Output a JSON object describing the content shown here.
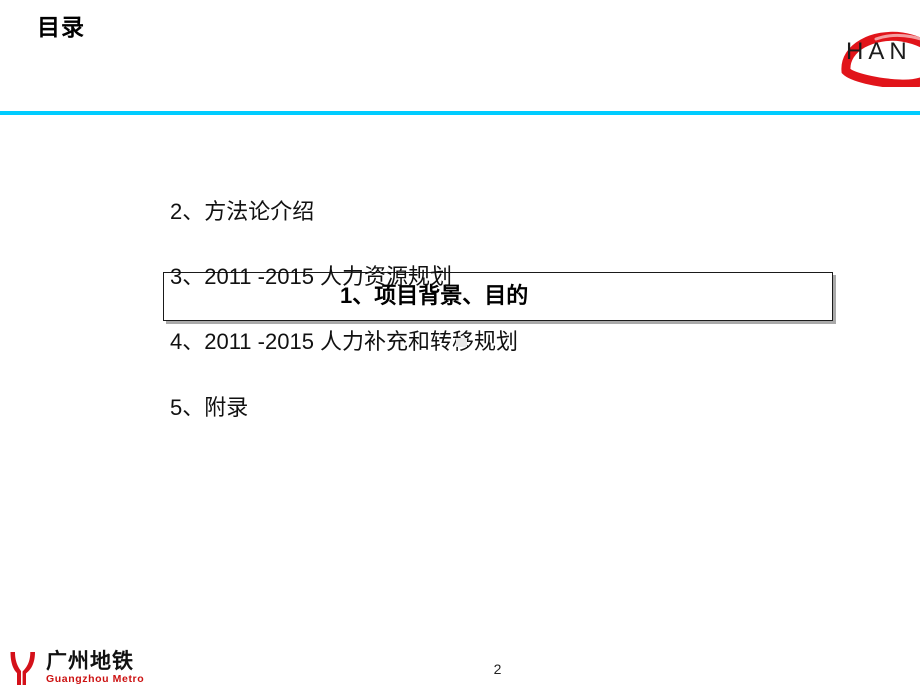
{
  "slide": {
    "title": "目录",
    "page_number": "2",
    "accent_color": "#00ccff",
    "brand_red": "#e1141a",
    "metro_red": "#cc1111"
  },
  "brand_logo": {
    "wordmark": "HAN",
    "icon_name": "hand-swoosh-logo"
  },
  "agenda": {
    "items": [
      {
        "label": "1、项目背景、目的",
        "highlighted": true
      },
      {
        "label": "2、方法论介绍",
        "highlighted": false
      },
      {
        "label": "3、2011 -2015 人力资源规划",
        "highlighted": false
      },
      {
        "label": "4、2011 -2015 人力补充和转移规划",
        "highlighted": false
      },
      {
        "label": "5、附录",
        "highlighted": false
      }
    ]
  },
  "footer": {
    "logo_cn": "广州地铁",
    "logo_en": "Guangzhou Metro",
    "mark_name": "guangzhou-metro-mark"
  }
}
